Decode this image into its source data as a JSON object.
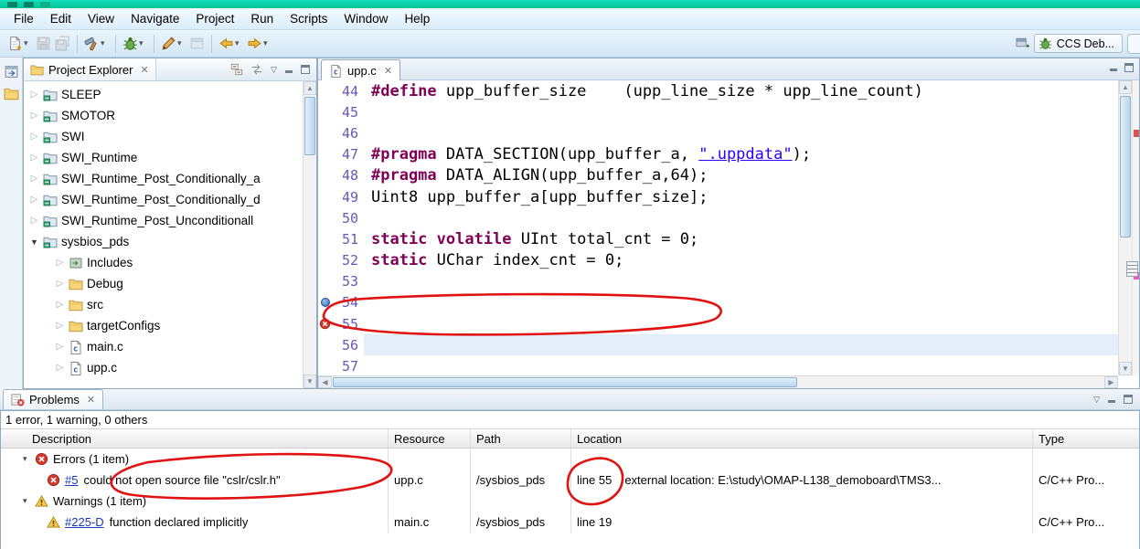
{
  "glyphs": {
    "close": "✕",
    "dropdown": "▾",
    "view_menu": "▽",
    "tree_collapsed": "▷",
    "tree_expanded": "▼",
    "group_twistie": "▾",
    "scroll_up": "▲",
    "scroll_down": "▼",
    "scroll_left": "◀",
    "scroll_right": "▶"
  },
  "window": {
    "perspective_label": "CCS Deb..."
  },
  "menu": {
    "items": [
      "File",
      "Edit",
      "View",
      "Navigate",
      "Project",
      "Run",
      "Scripts",
      "Window",
      "Help"
    ]
  },
  "explorer": {
    "tab_label": "Project Explorer",
    "items": [
      {
        "label": "SLEEP"
      },
      {
        "label": "SMOTOR"
      },
      {
        "label": "SWI"
      },
      {
        "label": "SWI_Runtime"
      },
      {
        "label": "SWI_Runtime_Post_Conditionally_a"
      },
      {
        "label": "SWI_Runtime_Post_Conditionally_d"
      },
      {
        "label": "SWI_Runtime_Post_Unconditionall"
      },
      {
        "label": "sysbios_pds"
      },
      {
        "label": "Includes"
      },
      {
        "label": "Debug"
      },
      {
        "label": "src"
      },
      {
        "label": "targetConfigs"
      },
      {
        "label": "main.c"
      },
      {
        "label": "upp.c"
      }
    ]
  },
  "editor": {
    "tab_label": "upp.c",
    "lines": [
      {
        "num": "44",
        "code": [
          {
            "t": "#define",
            "s": "preprocessor"
          },
          {
            "t": " upp_buffer_size    (upp_line_size * upp_line_count)",
            "s": "plain"
          }
        ]
      },
      {
        "num": "45",
        "code": []
      },
      {
        "num": "46",
        "code": []
      },
      {
        "num": "47",
        "code": [
          {
            "t": "#pragma",
            "s": "preprocessor"
          },
          {
            "t": " DATA_SECTION(upp_buffer_a, ",
            "s": "plain"
          },
          {
            "t": "\".uppdata\"",
            "s": "string"
          },
          {
            "t": ");",
            "s": "plain"
          }
        ]
      },
      {
        "num": "48",
        "code": [
          {
            "t": "#pragma",
            "s": "preprocessor"
          },
          {
            "t": " DATA_ALIGN(upp_buffer_a,64);",
            "s": "plain"
          }
        ]
      },
      {
        "num": "49",
        "code": [
          {
            "t": "Uint8 upp_buffer_a[upp_buffer_size];",
            "s": "plain"
          }
        ]
      },
      {
        "num": "50",
        "code": []
      },
      {
        "num": "51",
        "code": [
          {
            "t": "static volatile",
            "s": "keyword"
          },
          {
            "t": " UInt total_cnt = 0;",
            "s": "plain"
          }
        ]
      },
      {
        "num": "52",
        "code": [
          {
            "t": "static",
            "s": "keyword"
          },
          {
            "t": " UChar index_cnt = 0;",
            "s": "plain"
          }
        ]
      },
      {
        "num": "53",
        "code": []
      },
      {
        "num": "54",
        "code": [],
        "marker": "info"
      },
      {
        "num": "55",
        "code": [],
        "marker": "error"
      },
      {
        "num": "56",
        "code": [],
        "current": true
      },
      {
        "num": "57",
        "code": []
      }
    ]
  },
  "problems": {
    "tab_label": "Problems",
    "summary": "1 error, 1 warning, 0 others",
    "columns": {
      "description": "Description",
      "resource": "Resource",
      "path": "Path",
      "location": "Location",
      "type": "Type"
    },
    "errors_group_label": "Errors (1 item)",
    "warnings_group_label": "Warnings (1 item)",
    "error_row": {
      "id": "#5",
      "description": "could not open source file \"cslr/cslr.h\"",
      "resource": "upp.c",
      "path": "/sysbios_pds",
      "location_line": "line 55",
      "location_detail": "external location: E:\\study\\OMAP-L138_demoboard\\TMS3...",
      "type": "C/C++ Pro..."
    },
    "warning_row": {
      "id": "#225-D",
      "description": "function declared implicitly",
      "resource": "main.c",
      "path": "/sysbios_pds",
      "location_line": "line 19",
      "location_detail": "",
      "type": "C/C++ Pro..."
    }
  }
}
